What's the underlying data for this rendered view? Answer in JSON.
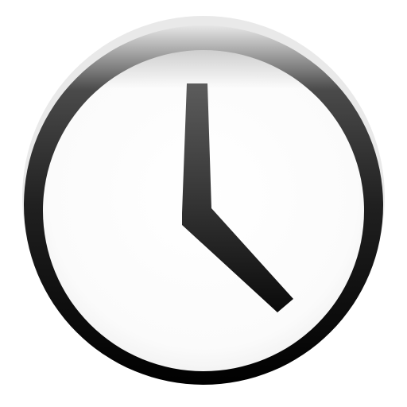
{
  "app_icon": {
    "name": "clock",
    "icon": "clock-icon",
    "colors": {
      "background": "#ffffff",
      "ring_dark": "#000000",
      "ring_mid": "#3a3a3a",
      "ring_light": "#dcdcdc",
      "face": "#ffffff",
      "face_shade": "#f2f2f2",
      "hand_top": "#5a5a5a",
      "hand_bottom": "#000000"
    }
  }
}
